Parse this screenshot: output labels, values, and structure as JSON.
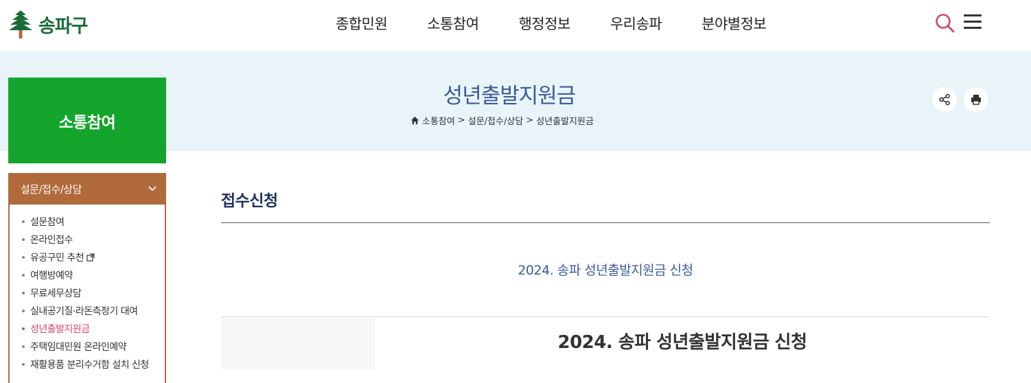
{
  "header": {
    "logo_text": "송파구",
    "nav": [
      "종합민원",
      "소통참여",
      "행정정보",
      "우리송파",
      "분야별정보"
    ],
    "icons": {
      "search": "search-icon",
      "menu": "hamburger-menu-icon"
    }
  },
  "banner": {
    "section_name": "소통참여",
    "page_title": "성년출발지원금",
    "breadcrumb": [
      "소통참여",
      "설문/접수/상담",
      "성년출발지원금"
    ],
    "breadcrumb_separator": ">"
  },
  "sidebar": {
    "heading": "설문/접수/상담",
    "items": [
      {
        "label": "설문참여",
        "active": false
      },
      {
        "label": "온라인접수",
        "active": false
      },
      {
        "label": "유공구민 추천",
        "active": false,
        "external": true
      },
      {
        "label": "여행방예약",
        "active": false
      },
      {
        "label": "무료세무상담",
        "active": false
      },
      {
        "label": "실내공기질·라돈측정기 대여",
        "active": false
      },
      {
        "label": "성년출발지원금",
        "active": true
      },
      {
        "label": "주택임대민원 온라인예약",
        "active": false
      },
      {
        "label": "재활용품 분리수거함 설치 신청",
        "active": false
      }
    ]
  },
  "content": {
    "title": "접수신청",
    "subtitle": "2024. 송파 성년출발지원금 신청",
    "table_title": "2024. 송파 성년출발지원금 신청"
  },
  "colors": {
    "brand_green": "#13a52b",
    "side_brown": "#b06a3b",
    "title_blue": "#3d5a9a",
    "active_pink": "#d0476a",
    "banner_bg": "#e8f4f8"
  }
}
